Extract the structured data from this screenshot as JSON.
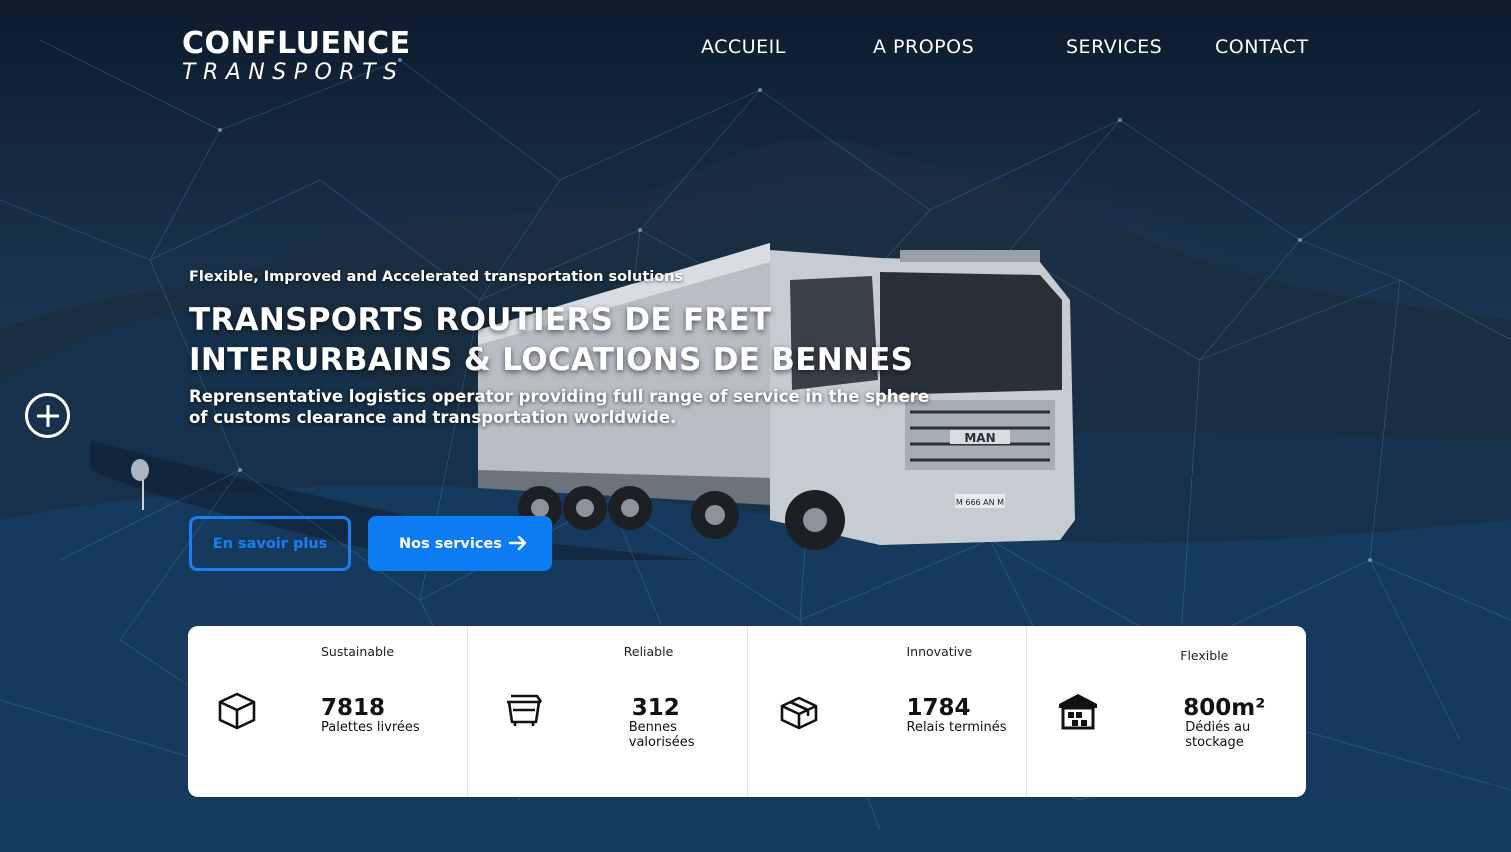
{
  "brand": {
    "name": "CONFLUENCE",
    "sub": "TRANSPORTS"
  },
  "nav": [
    "ACCUEIL",
    "A PROPOS",
    "SERVICES",
    "CONTACT"
  ],
  "hero": {
    "tagline": "Flexible, Improved and Accelerated transportation solutions",
    "headline_line1": "TRANSPORTS ROUTIERS DE FRET",
    "headline_line2": "INTERURBAINS & LOCATIONS DE BENNES",
    "description": "Reprensentative logistics operator providing full range of service in the sphere of customs clearance and transportation worldwide.",
    "truck_plate": "M 666 AN M",
    "truck_badge": "MAN"
  },
  "buttons": {
    "secondary": "En savoir plus",
    "primary": "Nos services"
  },
  "stats": [
    {
      "category": "Sustainable",
      "value": "7818",
      "label": "Palettes livrées",
      "icon": "box-icon"
    },
    {
      "category": "Reliable",
      "value": "312",
      "label": "Bennes valorisées",
      "icon": "dumpster-icon"
    },
    {
      "category": "Innovative",
      "value": "1784",
      "label": "Relais terminés",
      "icon": "package-icon"
    },
    {
      "category": "Flexible",
      "value": "800m²",
      "label": "Dédiés au stockage",
      "icon": "warehouse-icon"
    }
  ],
  "colors": {
    "accent": "#0d7cf2",
    "card": "#ffffff"
  }
}
